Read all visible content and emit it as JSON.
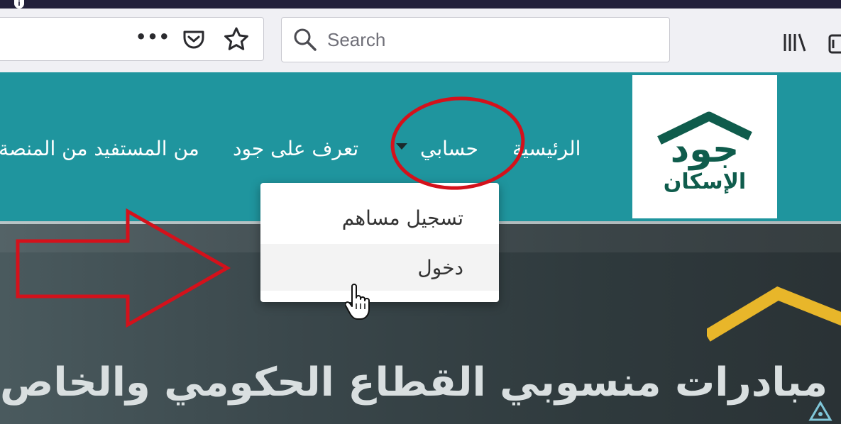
{
  "browser": {
    "search_placeholder": "Search",
    "icons": [
      "info-icon",
      "more-icon",
      "pocket-icon",
      "bookmark-star-icon",
      "search-icon",
      "library-icon",
      "sidebar-icon"
    ]
  },
  "site": {
    "logo_text_main": "جود",
    "logo_text_sub": "الإسكان",
    "nav": {
      "home": "الرئيسية",
      "account": "حسابي",
      "about": "تعرف على جود",
      "beneficiary": "من المستفيد من المنصة"
    },
    "dropdown": {
      "register": "تسجيل مساهم",
      "login": "دخول"
    },
    "hero_title": "مبادرات منسوبي القطاع الحكومي والخاص"
  },
  "colors": {
    "nav_bg": "#1f959e",
    "logo_green": "#0f5c4c",
    "annotation_red": "#d4111b",
    "roof_yellow": "#e8b62a"
  }
}
